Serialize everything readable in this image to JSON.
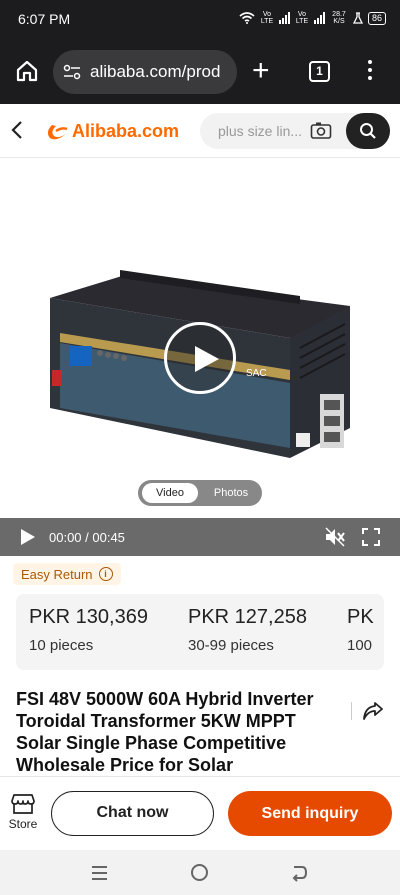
{
  "status_bar": {
    "time": "6:07 PM",
    "net1": "Vo LTE",
    "net2": "Vo LTE",
    "speed": "28.7 K/S",
    "battery": "86"
  },
  "browser": {
    "url": "alibaba.com/prod",
    "tab_count": "1"
  },
  "header": {
    "logo_text": "Alibaba.com",
    "search_placeholder": "plus size lin..."
  },
  "media": {
    "toggle_video": "Video",
    "toggle_photos": "Photos",
    "device_brand": "SAC"
  },
  "video": {
    "time": "00:00 / 00:45"
  },
  "easy_return": {
    "label": "Easy Return"
  },
  "price_tiers": [
    {
      "price": "PKR 130,369",
      "qty": "10 pieces"
    },
    {
      "price": "PKR 127,258",
      "qty": "30-99 pieces"
    },
    {
      "price": "PK",
      "qty": "100"
    }
  ],
  "product": {
    "title": "FSI 48V 5000W 60A Hybrid Inverter Toroidal Transformer 5KW MPPT Solar Single Phase Competitive Wholesale Price for Solar"
  },
  "actions": {
    "store_label": "Store",
    "chat_label": "Chat now",
    "inquiry_label": "Send inquiry"
  },
  "colors": {
    "brand": "#ff6a00",
    "inquiry": "#e64a00",
    "status_bg": "#1c1c1e"
  }
}
